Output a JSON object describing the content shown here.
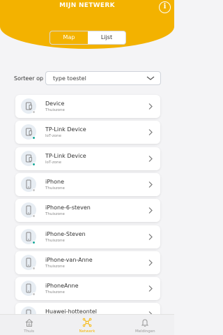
{
  "header": {
    "title": "MIJN NETWERK",
    "info_icon": "info-icon",
    "info_label": "i"
  },
  "toggle": {
    "tabs": [
      {
        "label": "Map",
        "active": true
      },
      {
        "label": "Lijst",
        "active": false
      }
    ]
  },
  "sort": {
    "label": "Sorteer op",
    "value": "type toestel"
  },
  "devices": [
    {
      "name": "Device",
      "zone": "Thuiszone",
      "icon": "tablet-icon",
      "status": "offline"
    },
    {
      "name": "TP-Link Device",
      "zone": "IoT-zone",
      "icon": "tablet-icon",
      "status": "online"
    },
    {
      "name": "TP-Link Device",
      "zone": "IoT-zone",
      "icon": "tablet-icon",
      "status": "online"
    },
    {
      "name": "iPhone",
      "zone": "Thuiszone",
      "icon": "phone-icon",
      "status": "offline"
    },
    {
      "name": "iPhone-6-steven",
      "zone": "Thuiszone",
      "icon": "phone-icon",
      "status": "offline"
    },
    {
      "name": "iPhone-Steven",
      "zone": "Thuiszone",
      "icon": "phone-icon",
      "status": "online"
    },
    {
      "name": "iPhone-van-Anne",
      "zone": "Thuiszone",
      "icon": "phone-icon",
      "status": "offline"
    },
    {
      "name": "iPhoneAnne",
      "zone": "Thuiszone",
      "icon": "phone-icon",
      "status": "offline"
    },
    {
      "name": "Huawei-hotteontel",
      "zone": "",
      "icon": "phone-icon",
      "status": "offline"
    }
  ],
  "tabbar": [
    {
      "label": "Thuis",
      "icon": "home-icon",
      "active": false
    },
    {
      "label": "Netwerk",
      "icon": "network-icon",
      "active": true
    },
    {
      "label": "Meldingen",
      "icon": "bell-icon",
      "active": false
    }
  ],
  "colors": {
    "accent": "#f3b200",
    "online": "#1aa89a",
    "offline": "#c8c8c8"
  }
}
